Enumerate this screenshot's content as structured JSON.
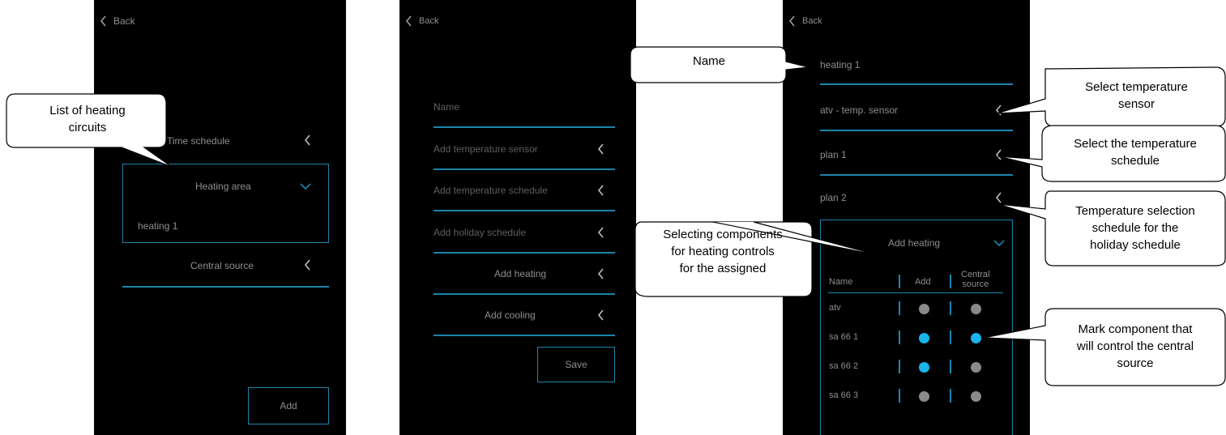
{
  "screen1": {
    "back": "Back",
    "time_schedule": "Time schedule",
    "heating_area": "Heating area",
    "heating_item": "heating 1",
    "central_source": "Central source",
    "add_button": "Add"
  },
  "screen2": {
    "back": "Back",
    "name_placeholder": "Name",
    "add_temp_sensor": "Add temperature sensor",
    "add_temp_schedule": "Add temperature schedule",
    "add_holiday_schedule": "Add holiday schedule",
    "add_heating": "Add heating",
    "add_cooling": "Add cooling",
    "save_button": "Save"
  },
  "screen3": {
    "back": "Back",
    "name_value": "heating 1",
    "sensor": "atv - temp. sensor",
    "plan1": "plan 1",
    "plan2": "plan 2",
    "add_heating": "Add heating",
    "columns": {
      "name": "Name",
      "add": "Add",
      "central_line1": "Central",
      "central_line2": "source"
    },
    "rows": [
      {
        "name": "atv",
        "add": false,
        "central": false
      },
      {
        "name": "sa 66 1",
        "add": true,
        "central": true
      },
      {
        "name": "sa 66 2",
        "add": true,
        "central": false
      },
      {
        "name": "sa 66 3",
        "add": false,
        "central": false
      }
    ]
  },
  "callouts": {
    "list_heating": [
      "List of heating",
      "circuits"
    ],
    "name": [
      "Name"
    ],
    "select_sensor": [
      "Select temperature",
      "sensor"
    ],
    "select_schedule": [
      "Select the temperature",
      "schedule"
    ],
    "holiday": [
      "Temperature selection",
      "schedule for the",
      "holiday schedule"
    ],
    "selecting": [
      "Selecting components",
      "for heating controls",
      "for the assigned"
    ],
    "mark": [
      "Mark component that",
      "will control the central",
      "source"
    ]
  },
  "colors": {
    "accent": "#1d84aa",
    "dot_on": "#19b5ec",
    "dot_off": "#8a8a8a",
    "text": "#8e8e8e"
  }
}
